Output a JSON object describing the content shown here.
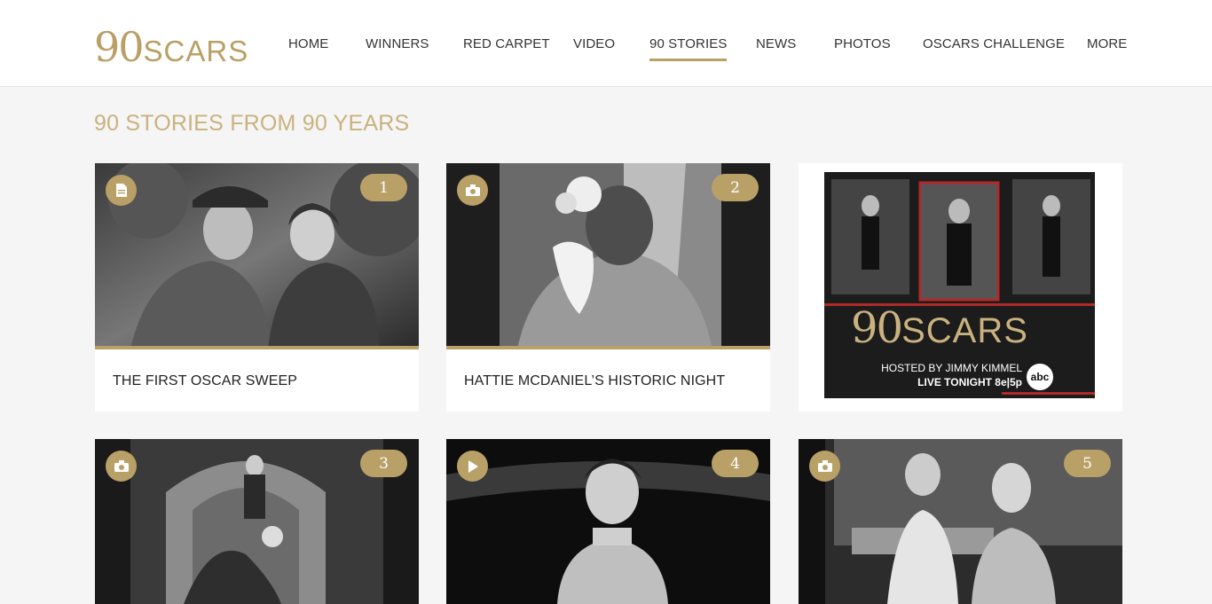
{
  "logo": {
    "num": "90",
    "word": "SCARS"
  },
  "nav": [
    {
      "label": "HOME"
    },
    {
      "label": "WINNERS"
    },
    {
      "label": "RED CARPET"
    },
    {
      "label": "VIDEO"
    },
    {
      "label": "90 STORIES",
      "active": true
    },
    {
      "label": "NEWS"
    },
    {
      "label": "PHOTOS"
    },
    {
      "label": "OSCARS CHALLENGE"
    },
    {
      "label": "MORE"
    }
  ],
  "section_title": "90 STORIES FROM 90 YEARS",
  "cards": [
    {
      "number": "1",
      "type": "document-icon",
      "caption": "THE FIRST OSCAR SWEEP"
    },
    {
      "number": "2",
      "type": "camera-icon",
      "caption": "HATTIE MCDANIEL’S HISTORIC NIGHT"
    },
    {
      "number": "3",
      "type": "camera-icon",
      "caption": ""
    },
    {
      "number": "4",
      "type": "play-icon",
      "caption": ""
    },
    {
      "number": "5",
      "type": "camera-icon",
      "caption": ""
    }
  ],
  "ad": {
    "logo_num": "90",
    "logo_word": "SCARS",
    "hosted_line1": "HOSTED BY JIMMY KIMMEL",
    "hosted_line2": "LIVE TONIGHT 8e|5p",
    "network": "abc"
  },
  "colors": {
    "gold": "#b9a067",
    "title_gold": "#c9b27f",
    "background": "#f5f5f5"
  }
}
